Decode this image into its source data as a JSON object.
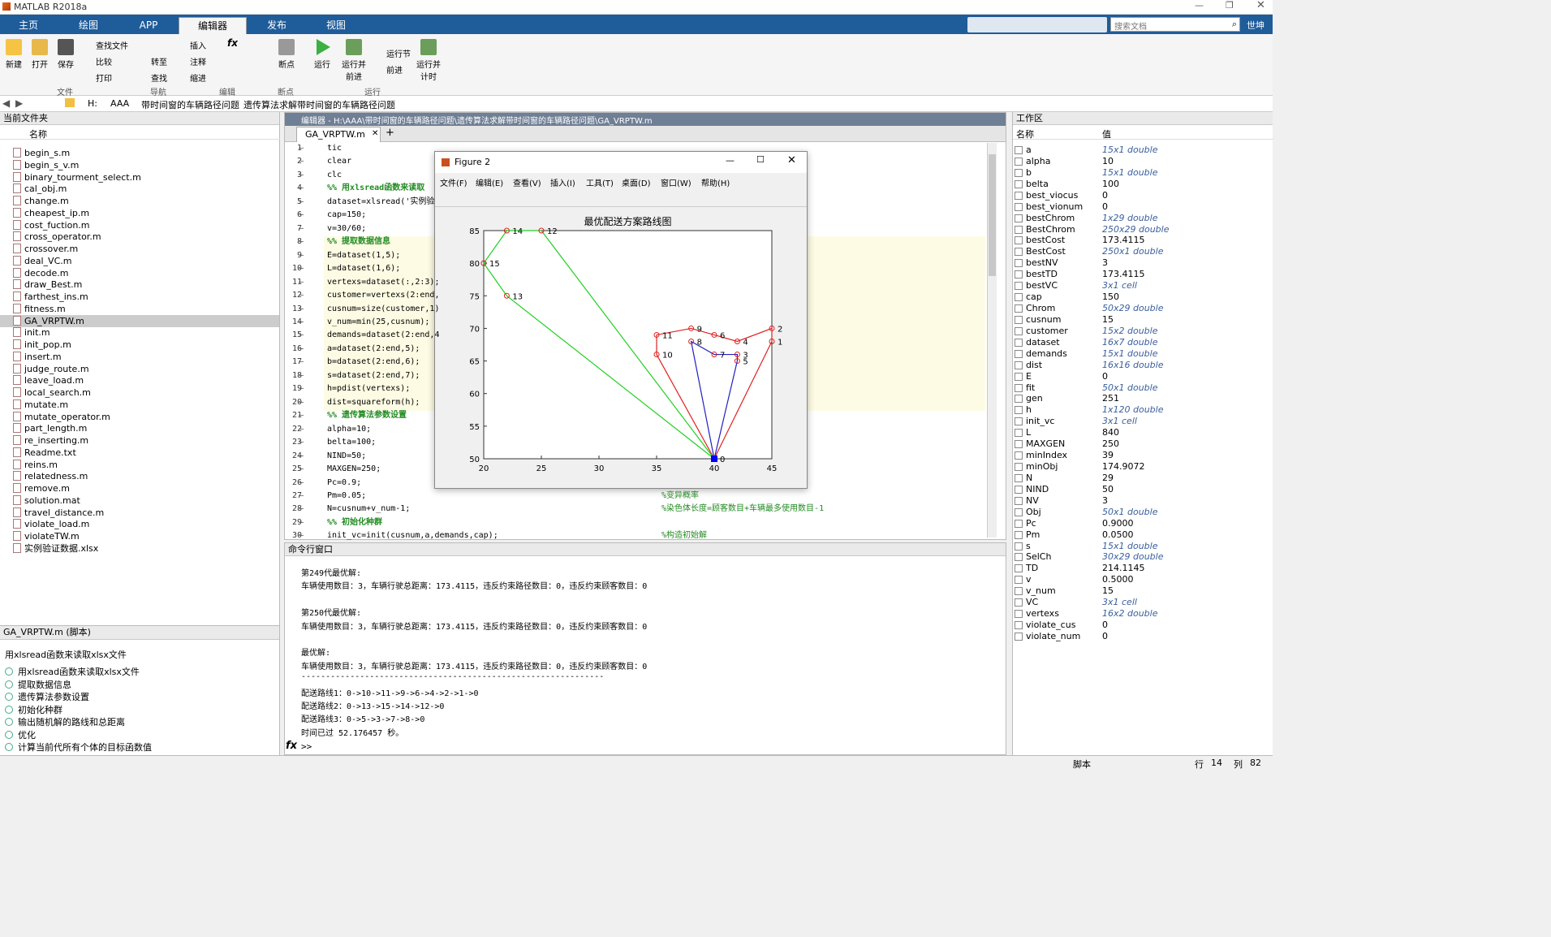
{
  "window": {
    "title": "MATLAB R2018a",
    "user": "世坤",
    "search_placeholder": "搜索文档"
  },
  "tabs": [
    "主页",
    "绘图",
    "APP",
    "编辑器",
    "发布",
    "视图"
  ],
  "ribbon": {
    "file": [
      "新建",
      "打开",
      "保存"
    ],
    "file_small": [
      "查找文件",
      "比较",
      "打印"
    ],
    "nav_small": [
      "转至",
      "查找"
    ],
    "edit_small": [
      "插入",
      "注释",
      "缩进"
    ],
    "breakpoint": "断点",
    "run": [
      "运行",
      "运行并\n前进",
      "运行节",
      "前进",
      "运行并\n计时"
    ],
    "sections": [
      "文件",
      "导航",
      "编辑",
      "断点",
      "运行"
    ]
  },
  "address": [
    "H:",
    "AAA",
    "带时间窗的车辆路径问题",
    "遗传算法求解带时间窗的车辆路径问题"
  ],
  "current_folder": {
    "title": "当前文件夹",
    "col": "名称",
    "files": [
      "begin_s.m",
      "begin_s_v.m",
      "binary_tourment_select.m",
      "cal_obj.m",
      "change.m",
      "cheapest_ip.m",
      "cost_fuction.m",
      "cross_operator.m",
      "crossover.m",
      "deal_VC.m",
      "decode.m",
      "draw_Best.m",
      "farthest_ins.m",
      "fitness.m",
      "GA_VRPTW.m",
      "init.m",
      "init_pop.m",
      "insert.m",
      "judge_route.m",
      "leave_load.m",
      "local_search.m",
      "mutate.m",
      "mutate_operator.m",
      "part_length.m",
      "re_inserting.m",
      "Readme.txt",
      "reins.m",
      "relatedness.m",
      "remove.m",
      "solution.mat",
      "travel_distance.m",
      "violate_load.m",
      "violateTW.m",
      "实例验证数据.xlsx"
    ]
  },
  "details": {
    "title": "GA_VRPTW.m  (脚本)",
    "desc": "用xlsread函数来读取xlsx文件",
    "items": [
      "用xlsread函数来读取xlsx文件",
      "提取数据信息",
      "遗传算法参数设置",
      "初始化种群",
      "输出随机解的路线和总距离",
      "优化",
      "计算当前代所有个体的目标函数值"
    ]
  },
  "editor": {
    "title": "编辑器 - H:\\AAA\\带时间窗的车辆路径问题\\遗传算法求解带时间窗的车辆路径问题\\GA_VRPTW.m",
    "tab": "GA_VRPTW.m",
    "lines": [
      {
        "n": "1",
        "t": "tic",
        "c": false
      },
      {
        "n": "2",
        "t": "clear",
        "c": false
      },
      {
        "n": "3",
        "t": "clc",
        "c": false
      },
      {
        "n": "4",
        "t": "%% 用xlsread函数来读取",
        "c": true
      },
      {
        "n": "5",
        "t": "dataset=xlsread('实例验",
        "c": false
      },
      {
        "n": "6",
        "t": "cap=150;",
        "c": false
      },
      {
        "n": "7",
        "t": "v=30/60;",
        "c": false
      },
      {
        "n": "8",
        "t": "%% 提取数据信息",
        "c": true
      },
      {
        "n": "9",
        "t": "E=dataset(1,5);",
        "c": false
      },
      {
        "n": "10",
        "t": "L=dataset(1,6);",
        "c": false
      },
      {
        "n": "11",
        "t": "vertexs=dataset(:,2:3);",
        "c": false
      },
      {
        "n": "12",
        "t": "customer=vertexs(2:end,",
        "c": false
      },
      {
        "n": "13",
        "t": "cusnum=size(customer,1)",
        "c": false
      },
      {
        "n": "14",
        "t": "v_num=min(25,cusnum);",
        "c": false
      },
      {
        "n": "15",
        "t": "demands=dataset(2:end,4",
        "c": false
      },
      {
        "n": "16",
        "t": "a=dataset(2:end,5);",
        "c": false
      },
      {
        "n": "17",
        "t": "b=dataset(2:end,6);",
        "c": false
      },
      {
        "n": "18",
        "t": "s=dataset(2:end,7);",
        "c": false
      },
      {
        "n": "19",
        "t": "h=pdist(vertexs);",
        "c": false
      },
      {
        "n": "20",
        "t": "dist=squareform(h);",
        "c": false
      },
      {
        "n": "21",
        "t": "%% 遗传算法参数设置",
        "c": true
      },
      {
        "n": "22",
        "t": "alpha=10;",
        "c": false
      },
      {
        "n": "23",
        "t": "belta=100;",
        "c": false
      },
      {
        "n": "24",
        "t": "NIND=50;",
        "c": false
      },
      {
        "n": "25",
        "t": "MAXGEN=250;",
        "c": false
      },
      {
        "n": "26",
        "t": "Pc=0.9;",
        "c": false
      },
      {
        "n": "27",
        "t": "Pm=0.05;",
        "c": false
      },
      {
        "n": "28",
        "t": "N=cusnum+v_num-1;",
        "c": false
      },
      {
        "n": "29",
        "t": "%% 初始化种群",
        "c": true
      },
      {
        "n": "30",
        "t": "init_vc=init(cusnum,a,demands,cap);",
        "c": false
      }
    ],
    "comments": {
      "27": "%变异概率",
      "28": "%染色体长度=顾客数目+车辆最多使用数目-1",
      "30": "%构造初始解"
    }
  },
  "figure": {
    "title": "Figure 2",
    "menu": [
      "文件(F)",
      "编辑(E)",
      "查看(V)",
      "插入(I)",
      "工具(T)",
      "桌面(D)",
      "窗口(W)",
      "帮助(H)"
    ]
  },
  "chart_data": {
    "type": "line",
    "title": "最优配送方案路线图",
    "xlabel": "",
    "ylabel": "",
    "xlim": [
      20,
      45
    ],
    "ylim": [
      50,
      85
    ],
    "xticks": [
      20,
      25,
      30,
      35,
      40,
      45
    ],
    "yticks": [
      50,
      55,
      60,
      65,
      70,
      75,
      80,
      85
    ],
    "nodes": [
      {
        "id": "0",
        "x": 40,
        "y": 50
      },
      {
        "id": "1",
        "x": 45,
        "y": 68
      },
      {
        "id": "2",
        "x": 45,
        "y": 70
      },
      {
        "id": "3",
        "x": 42,
        "y": 66
      },
      {
        "id": "4",
        "x": 42,
        "y": 68
      },
      {
        "id": "5",
        "x": 42,
        "y": 65
      },
      {
        "id": "6",
        "x": 40,
        "y": 69
      },
      {
        "id": "7",
        "x": 40,
        "y": 66
      },
      {
        "id": "8",
        "x": 38,
        "y": 68
      },
      {
        "id": "9",
        "x": 38,
        "y": 70
      },
      {
        "id": "10",
        "x": 35,
        "y": 66
      },
      {
        "id": "11",
        "x": 35,
        "y": 69
      },
      {
        "id": "12",
        "x": 25,
        "y": 85
      },
      {
        "id": "13",
        "x": 22,
        "y": 75
      },
      {
        "id": "14",
        "x": 22,
        "y": 85
      },
      {
        "id": "15",
        "x": 20,
        "y": 80
      }
    ],
    "series": [
      {
        "color": "#e02020",
        "route": [
          "0",
          "10",
          "11",
          "9",
          "6",
          "4",
          "2",
          "1",
          "0"
        ]
      },
      {
        "color": "#20d020",
        "route": [
          "0",
          "13",
          "15",
          "14",
          "12",
          "0"
        ]
      },
      {
        "color": "#2020c0",
        "route": [
          "0",
          "5",
          "3",
          "7",
          "8",
          "0"
        ]
      }
    ]
  },
  "command": {
    "title": "命令行窗口",
    "lines": [
      "第249代最优解:",
      "车辆使用数目：3，车辆行驶总距离：173.4115，违反约束路径数目：0，违反约束顾客数目：0",
      "",
      "第250代最优解:",
      "车辆使用数目：3，车辆行驶总距离：173.4115，违反约束路径数目：0，违反约束顾客数目：0",
      "",
      "最优解:",
      "车辆使用数目：3，车辆行驶总距离：173.4115，违反约束路径数目：0，违反约束顾客数目：0",
      "--------------------------------------------------------------",
      "配送路线1：0->10->11->9->6->4->2->1->0",
      "配送路线2：0->13->15->14->12->0",
      "配送路线3：0->5->3->7->8->0",
      "时间已过 52.176457 秒。"
    ],
    "prompt": ">>"
  },
  "workspace": {
    "title": "工作区",
    "col_name": "名称",
    "col_value": "值",
    "vars": [
      [
        "a",
        "15x1 double",
        1
      ],
      [
        "alpha",
        "10",
        0
      ],
      [
        "b",
        "15x1 double",
        1
      ],
      [
        "belta",
        "100",
        0
      ],
      [
        "best_viocus",
        "0",
        0
      ],
      [
        "best_vionum",
        "0",
        0
      ],
      [
        "bestChrom",
        "1x29 double",
        1
      ],
      [
        "BestChrom",
        "250x29 double",
        1
      ],
      [
        "bestCost",
        "173.4115",
        0
      ],
      [
        "BestCost",
        "250x1 double",
        1
      ],
      [
        "bestNV",
        "3",
        0
      ],
      [
        "bestTD",
        "173.4115",
        0
      ],
      [
        "bestVC",
        "3x1 cell",
        1
      ],
      [
        "cap",
        "150",
        0
      ],
      [
        "Chrom",
        "50x29 double",
        1
      ],
      [
        "cusnum",
        "15",
        0
      ],
      [
        "customer",
        "15x2 double",
        1
      ],
      [
        "dataset",
        "16x7 double",
        1
      ],
      [
        "demands",
        "15x1 double",
        1
      ],
      [
        "dist",
        "16x16 double",
        1
      ],
      [
        "E",
        "0",
        0
      ],
      [
        "fit",
        "50x1 double",
        1
      ],
      [
        "gen",
        "251",
        0
      ],
      [
        "h",
        "1x120 double",
        1
      ],
      [
        "init_vc",
        "3x1 cell",
        1
      ],
      [
        "L",
        "840",
        0
      ],
      [
        "MAXGEN",
        "250",
        0
      ],
      [
        "minIndex",
        "39",
        0
      ],
      [
        "minObj",
        "174.9072",
        0
      ],
      [
        "N",
        "29",
        0
      ],
      [
        "NIND",
        "50",
        0
      ],
      [
        "NV",
        "3",
        0
      ],
      [
        "Obj",
        "50x1 double",
        1
      ],
      [
        "Pc",
        "0.9000",
        0
      ],
      [
        "Pm",
        "0.0500",
        0
      ],
      [
        "s",
        "15x1 double",
        1
      ],
      [
        "SelCh",
        "30x29 double",
        1
      ],
      [
        "TD",
        "214.1145",
        0
      ],
      [
        "v",
        "0.5000",
        0
      ],
      [
        "v_num",
        "15",
        0
      ],
      [
        "VC",
        "3x1 cell",
        1
      ],
      [
        "vertexs",
        "16x2 double",
        1
      ],
      [
        "violate_cus",
        "0",
        0
      ],
      [
        "violate_num",
        "0",
        0
      ]
    ]
  },
  "status": {
    "mode": "脚本",
    "row_label": "行",
    "row": "14",
    "col_label": "列",
    "col": "82"
  }
}
